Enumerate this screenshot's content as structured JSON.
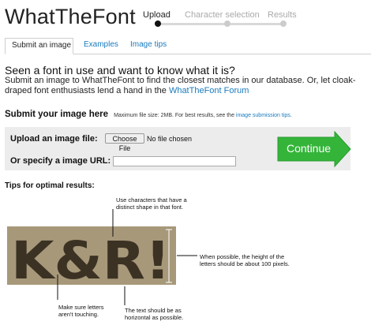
{
  "logo": "WhatTheFont",
  "steps": [
    {
      "label": "Upload",
      "active": true
    },
    {
      "label": "Character selection",
      "active": false
    },
    {
      "label": "Results",
      "active": false
    }
  ],
  "tabs": [
    {
      "label": "Submit an image",
      "active": true
    },
    {
      "label": "Examples",
      "active": false
    },
    {
      "label": "Image tips",
      "active": false
    }
  ],
  "headline": "Seen a font in use and want to know what it is?",
  "intro": {
    "text": "Submit an image to WhatTheFont to find the closest matches in our database. Or, let cloak-draped font enthusiasts lend a hand in the ",
    "link": "WhatTheFont Forum"
  },
  "submit": {
    "title": "Submit your image here",
    "note": "Maximum file size: 2MB. For best results, see the ",
    "note_link": "image submission tips."
  },
  "form": {
    "upload_label": "Upload an image file:",
    "choose_button": "Choose File",
    "no_file": "No file chosen",
    "url_label": "Or specify a image URL:",
    "url_value": "",
    "continue_label": "Continue"
  },
  "tips": {
    "title": "Tips for optimal results:",
    "sample_text": "K&R!",
    "annotations": {
      "shape": "Use characters that have a distinct shape in that font.",
      "height": "When possible, the height of the letters should be about 100 pixels.",
      "touching": "Make sure letters aren't touching.",
      "horizontal": "The text should be as horizontal as possible."
    }
  },
  "colors": {
    "link": "#1a7bbd",
    "continue_green": "#34b53a",
    "sample_bg": "#a7987a",
    "sample_letters": "#3b3224"
  }
}
